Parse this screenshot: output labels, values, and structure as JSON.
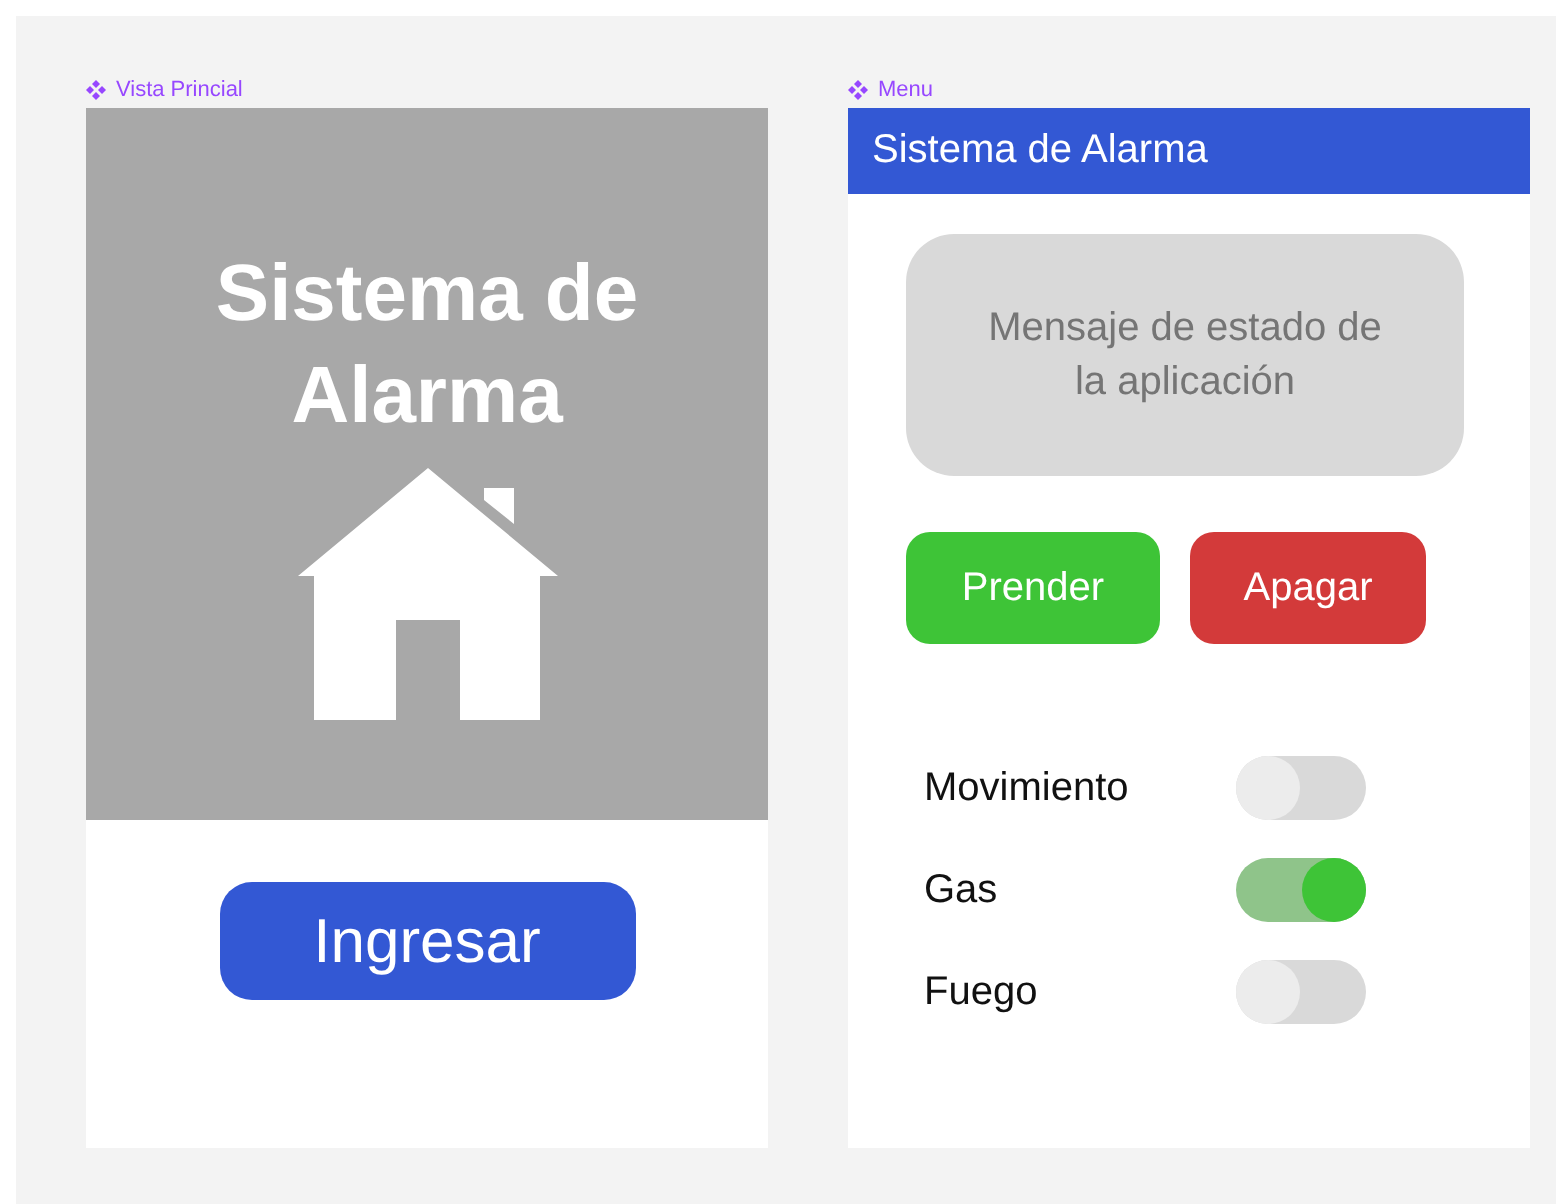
{
  "main_view": {
    "frame_label": "Vista Princial",
    "title": "Sistema de Alarma",
    "button": "Ingresar"
  },
  "menu": {
    "frame_label": "Menu",
    "header": "Sistema de Alarma",
    "message": "Mensaje de estado de la aplicación",
    "buttons": [
      {
        "label": "Prender",
        "kind": "on"
      },
      {
        "label": "Apagar",
        "kind": "off"
      }
    ],
    "switches": [
      {
        "label": "Movimiento",
        "on": false
      },
      {
        "label": "Gas",
        "on": true
      },
      {
        "label": "Fuego",
        "on": false
      }
    ]
  }
}
